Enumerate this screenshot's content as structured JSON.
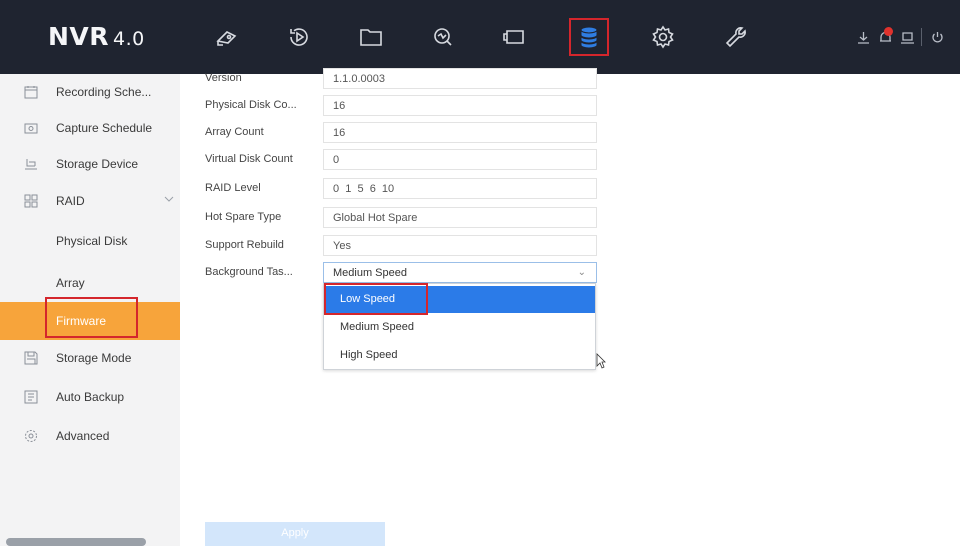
{
  "app": {
    "logo_text": "NVR",
    "logo_version": "4.0"
  },
  "topnav": {
    "icons": [
      "live-view-icon",
      "playback-icon",
      "file-management-icon",
      "smart-analysis-icon",
      "intelligent-icon",
      "storage-icon",
      "settings-icon",
      "maintenance-icon"
    ],
    "active": "storage-icon",
    "tray_icons": [
      "download-icon",
      "alarm-icon",
      "device-icon",
      "power-icon"
    ]
  },
  "sidebar": {
    "items": [
      {
        "label": "Recording Sche...",
        "icon": "calendar-icon"
      },
      {
        "label": "Capture Schedule",
        "icon": "camera-icon"
      },
      {
        "label": "Storage Device",
        "icon": "storage-device-icon"
      },
      {
        "label": "RAID",
        "icon": "grid-icon"
      },
      {
        "label": "Physical Disk"
      },
      {
        "label": "Array"
      },
      {
        "label": "Firmware"
      },
      {
        "label": "Storage Mode",
        "icon": "save-icon"
      },
      {
        "label": "Auto Backup",
        "icon": "backup-icon"
      },
      {
        "label": "Advanced",
        "icon": "advanced-gear-icon"
      }
    ],
    "active_item": "Firmware"
  },
  "form": {
    "rows": [
      {
        "label": "Version",
        "value": "1.1.0.0003"
      },
      {
        "label": "Physical Disk Co...",
        "value": "16"
      },
      {
        "label": "Array Count",
        "value": "16"
      },
      {
        "label": "Virtual Disk Count",
        "value": "0"
      },
      {
        "label": "RAID Level",
        "value": "0  1  5  6  10"
      },
      {
        "label": "Hot Spare Type",
        "value": "Global Hot Spare"
      },
      {
        "label": "Support Rebuild",
        "value": "Yes"
      },
      {
        "label": "Background Tas...",
        "value": "Medium Speed"
      }
    ]
  },
  "dropdown": {
    "options": [
      "Low Speed",
      "Medium Speed",
      "High Speed"
    ],
    "highlighted": "Low Speed"
  },
  "apply_label": "Apply",
  "colors": {
    "accent": "#f7a43b",
    "highlight": "#2b7be8",
    "topbar": "#1f2430",
    "annotation": "#d4262c"
  }
}
